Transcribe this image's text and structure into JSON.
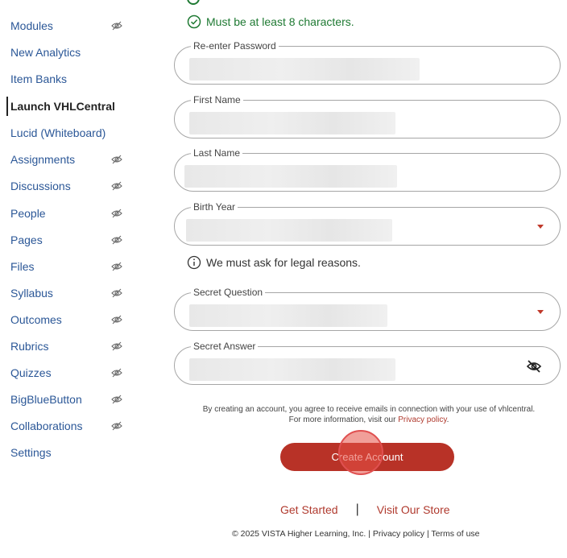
{
  "sidebar": {
    "items": [
      {
        "label": "Modules",
        "hidden": true
      },
      {
        "label": "New Analytics",
        "hidden": false
      },
      {
        "label": "Item Banks",
        "hidden": false
      },
      {
        "label": "Launch VHLCentral",
        "hidden": false,
        "active": true
      },
      {
        "label": "Lucid (Whiteboard)",
        "hidden": false
      },
      {
        "label": "Assignments",
        "hidden": true
      },
      {
        "label": "Discussions",
        "hidden": true
      },
      {
        "label": "People",
        "hidden": true
      },
      {
        "label": "Pages",
        "hidden": true
      },
      {
        "label": "Files",
        "hidden": true
      },
      {
        "label": "Syllabus",
        "hidden": true
      },
      {
        "label": "Outcomes",
        "hidden": true
      },
      {
        "label": "Rubrics",
        "hidden": true
      },
      {
        "label": "Quizzes",
        "hidden": true
      },
      {
        "label": "BigBlueButton",
        "hidden": true
      },
      {
        "label": "Collaborations",
        "hidden": true
      },
      {
        "label": "Settings",
        "hidden": false
      }
    ]
  },
  "form": {
    "password_rule": "Must be at least 8 characters.",
    "reenter_password": {
      "label": "Re-enter Password"
    },
    "first_name": {
      "label": "First Name"
    },
    "last_name": {
      "label": "Last Name"
    },
    "birth_year": {
      "label": "Birth Year"
    },
    "legal_note": "We must ask for legal reasons.",
    "secret_question": {
      "label": "Secret Question"
    },
    "secret_answer": {
      "label": "Secret Answer"
    },
    "consent_text": "By creating an account, you agree to receive emails in connection with your use of vhlcentral.",
    "privacy_prefix": "For more information, visit our",
    "privacy_link": "Privacy policy",
    "privacy_suffix": ".",
    "create_button": "Create Account"
  },
  "footer": {
    "get_started": "Get Started",
    "separator": "|",
    "visit_store": "Visit Our Store",
    "copyright": "© 2025 VISTA Higher Learning, Inc. | Privacy policy | Terms of use"
  },
  "colors": {
    "link": "#2b5797",
    "success": "#1f7a33",
    "brand": "#b83227"
  }
}
